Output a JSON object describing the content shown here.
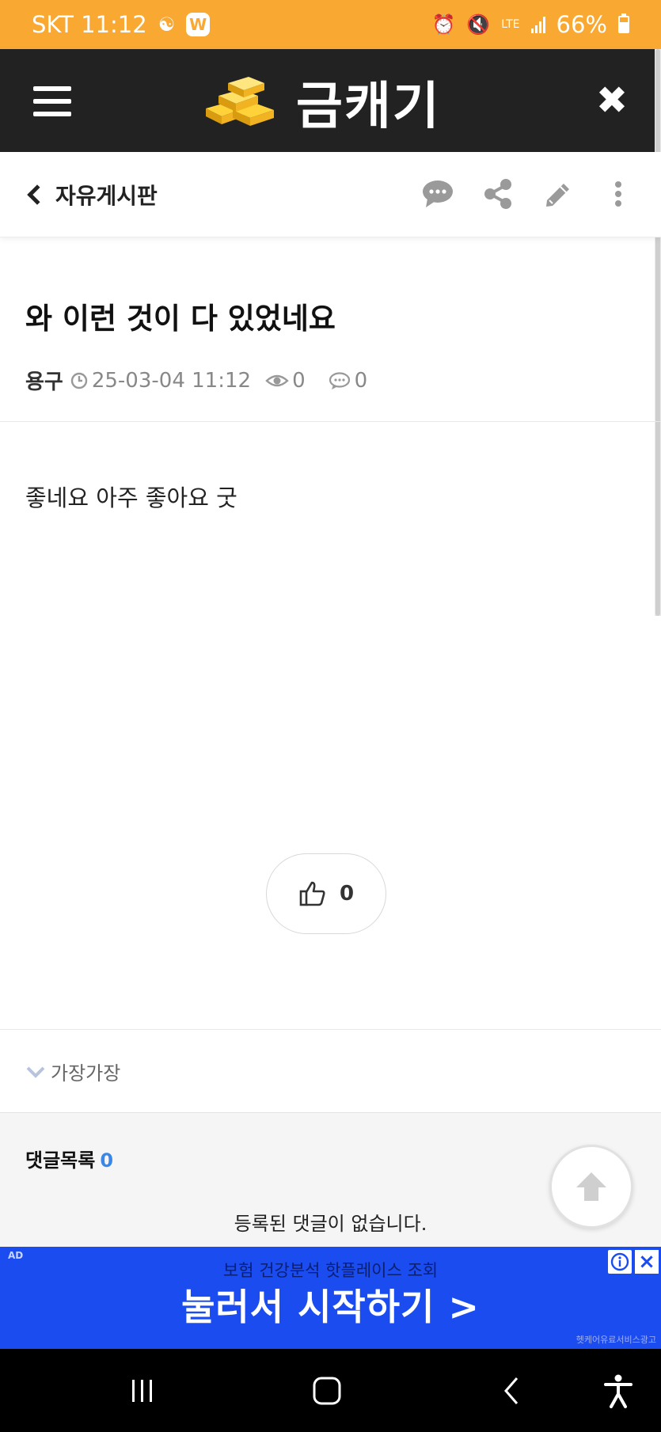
{
  "status_bar": {
    "carrier_time": "SKT 11:12",
    "app_badge": "W",
    "network": "LTE",
    "battery": "66%"
  },
  "header": {
    "title": "금캐기",
    "logo": "gold-bars-logo",
    "menu_icon": "hamburger-icon",
    "close_icon": "close-icon"
  },
  "board": {
    "name": "자유게시판",
    "tools": [
      "comment-icon",
      "share-icon",
      "edit-icon",
      "more-vertical-icon"
    ]
  },
  "post": {
    "title": "와 이런 것이 다 있었네요",
    "author": "용구",
    "datetime": "25-03-04 11:12",
    "views": "0",
    "comments": "0",
    "body": "좋네요 아주 좋아요 굿",
    "likes": "0",
    "tag": "가장가장"
  },
  "comments_section": {
    "title": "댓글목록",
    "count": "0",
    "empty_message": "등록된 댓글이 없습니다."
  },
  "ad": {
    "badge": "AD",
    "subtitle": "보험 건강분석 핫플레이스 조회",
    "headline": "눌러서 시작하기 >",
    "footnote": "헷케어유료서비스광고"
  },
  "colors": {
    "status_bar": "#f9a832",
    "header": "#222222",
    "accent": "#3a87e8",
    "ad": "#1a4cf0"
  }
}
